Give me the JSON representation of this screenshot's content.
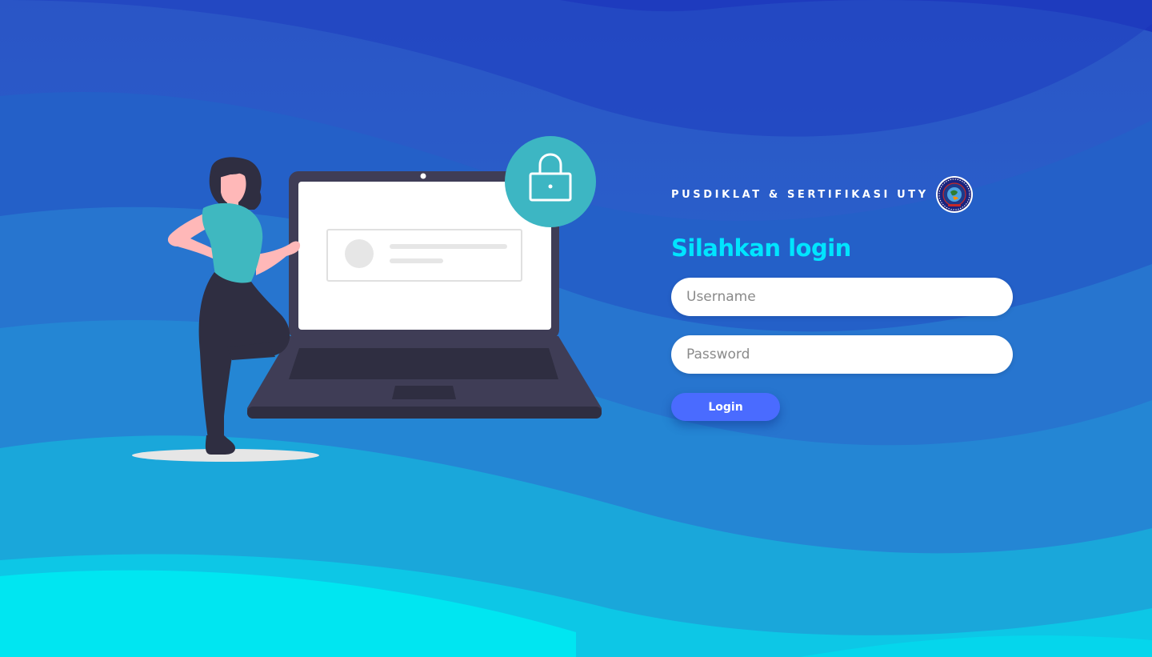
{
  "brand": {
    "name": "PUSDIKLAT & SERTIFIKASI UTY",
    "logo_icon": "university-seal-icon"
  },
  "login": {
    "heading": "Silahkan login",
    "username_placeholder": "Username",
    "password_placeholder": "Password",
    "button_label": "Login"
  },
  "illustration": {
    "subject": "woman-with-laptop-illustration",
    "lock_icon": "padlock-icon"
  },
  "colors": {
    "background_top": "#1e35bd",
    "background_bottom": "#00e8f2",
    "heading": "#00e5ff",
    "button": "#4a6bff",
    "lock_badge": "#3db6c3",
    "shirt": "#3fb8c0"
  }
}
